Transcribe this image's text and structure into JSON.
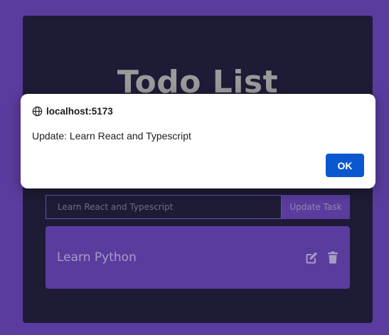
{
  "app": {
    "title": "Todo List",
    "input": {
      "value": "Learn React and Typescript",
      "placeholder": ""
    },
    "update_button_label": "Update Task",
    "tasks": [
      {
        "text": "Learn Python",
        "edit_icon": "edit-icon",
        "delete_icon": "trash-icon"
      }
    ]
  },
  "dialog": {
    "origin_icon": "globe-icon",
    "origin": "localhost:5173",
    "message": "Update: Learn React and Typescript",
    "ok_label": "OK"
  },
  "colors": {
    "page_background": "#5a3c9e",
    "card_background": "#1e1b36",
    "accent": "#5a3c9e",
    "dialog_button": "#0b57d0"
  }
}
